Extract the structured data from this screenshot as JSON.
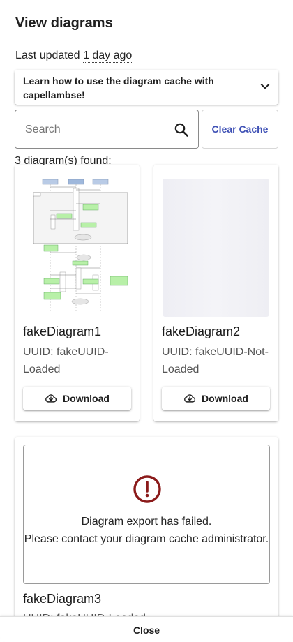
{
  "dialog": {
    "title": "View diagrams",
    "last_updated_prefix": "Last updated",
    "last_updated_value": "1 day ago"
  },
  "expander": {
    "text": "Learn how to use the diagram cache with capellambse!",
    "icon": "chevron-down-icon"
  },
  "search": {
    "placeholder": "Search",
    "value": "",
    "icon": "search-icon",
    "clear_label": "Clear Cache"
  },
  "results": {
    "count_text": "3 diagram(s) found:"
  },
  "diagrams": [
    {
      "name": "fakeDiagram1",
      "uuid": "UUID: fakeUUID-Loaded",
      "state": "loaded",
      "download_label": "Download",
      "download_icon": "cloud-download-icon"
    },
    {
      "name": "fakeDiagram2",
      "uuid": "UUID: fakeUUID-Not-Loaded",
      "state": "loading",
      "download_label": "Download",
      "download_icon": "cloud-download-icon"
    },
    {
      "name": "fakeDiagram3",
      "uuid": "UUID: fakeUUID-Loaded",
      "state": "error",
      "error_line1": "Diagram export has failed.",
      "error_line2": "Please contact your diagram cache administrator.",
      "error_icon": "error-circle-icon"
    }
  ],
  "footer": {
    "close_label": "Close"
  },
  "colors": {
    "accent": "#3f51b5",
    "error": "#8b1a1a",
    "diagram_green": "#b8f0a8",
    "diagram_blue": "#b9cbe6"
  }
}
